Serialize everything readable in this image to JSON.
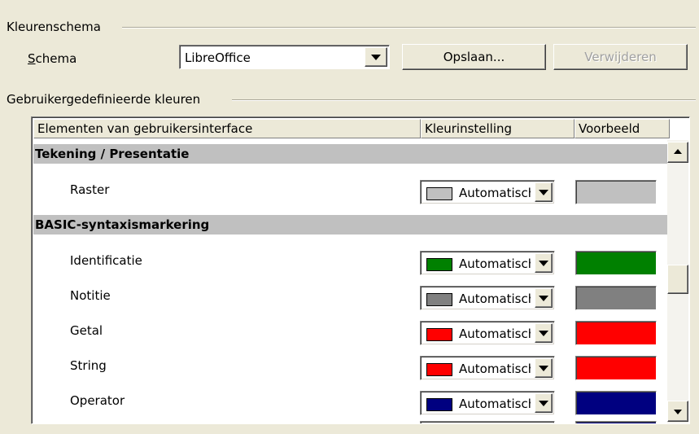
{
  "scheme_section": {
    "title": "Kleurenschema",
    "scheme_label": "Schema",
    "scheme_accesskey": "S",
    "scheme_value": "LibreOffice",
    "save_label": "Opslaan...",
    "delete_label": "Verwijderen"
  },
  "custom_section": {
    "title": "Gebruikergedefinieerde kleuren"
  },
  "table": {
    "headers": [
      "Elementen van gebruikersinterface",
      "Kleurinstelling",
      "Voorbeeld"
    ],
    "groups": [
      {
        "name": "Tekening / Presentatie",
        "items": [
          {
            "label": "Raster",
            "setting": "Automatisch",
            "color": "#c0c0c0"
          }
        ]
      },
      {
        "name": "BASIC-syntaxismarkering",
        "items": [
          {
            "label": "Identificatie",
            "setting": "Automatisch",
            "color": "#008000"
          },
          {
            "label": "Notitie",
            "setting": "Automatisch",
            "color": "#808080"
          },
          {
            "label": "Getal",
            "setting": "Automatisch",
            "color": "#ff0000"
          },
          {
            "label": "String",
            "setting": "Automatisch",
            "color": "#ff0000"
          },
          {
            "label": "Operator",
            "setting": "Automatisch",
            "color": "#000080"
          },
          {
            "label": "",
            "setting": "",
            "color": "#000080"
          }
        ]
      }
    ]
  },
  "scrollbar": {
    "position": 0.48
  }
}
